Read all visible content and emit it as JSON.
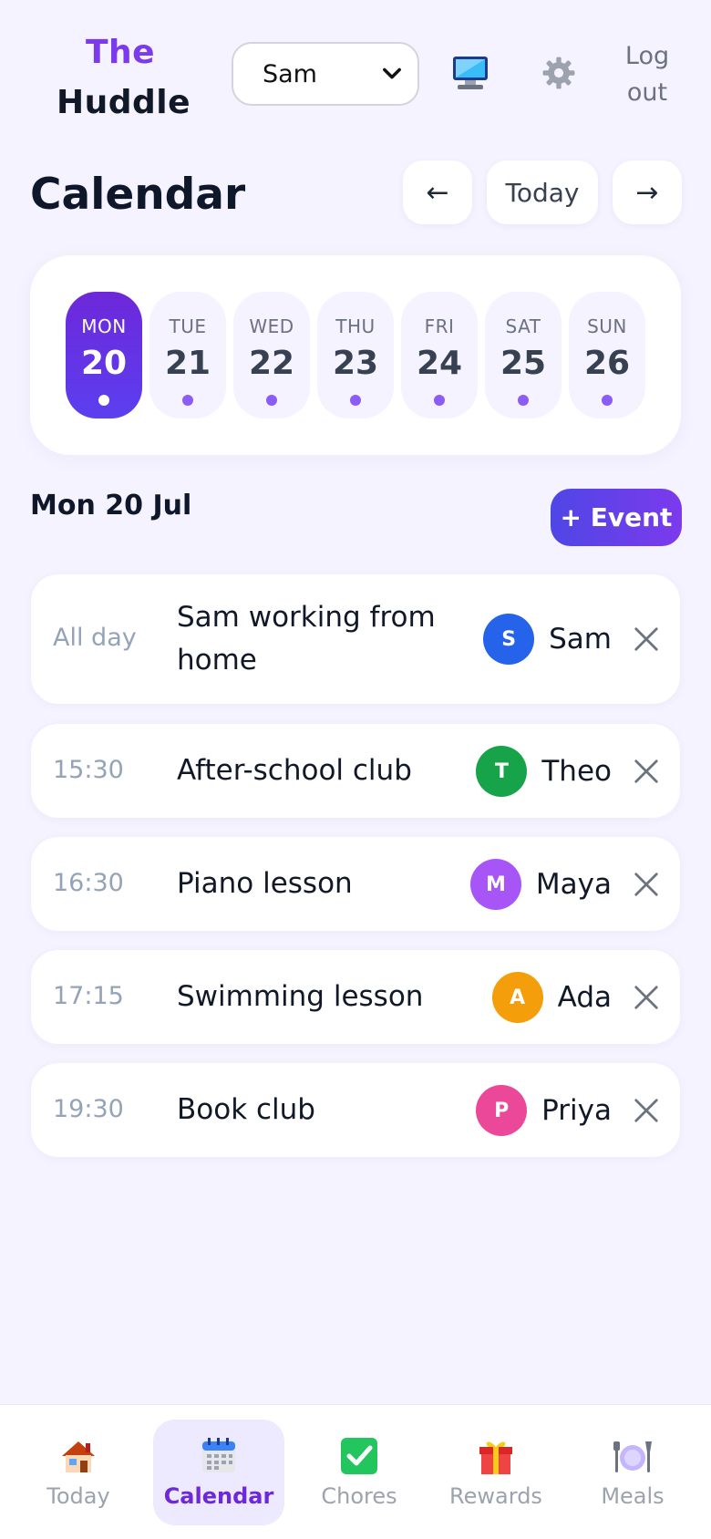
{
  "header": {
    "brand_line1": "The",
    "brand_line2": "Huddle",
    "user_select": {
      "value": "Sam"
    },
    "logout_label_1": "Log",
    "logout_label_2": "out"
  },
  "page": {
    "title": "Calendar",
    "prev_label": "←",
    "today_label": "Today",
    "next_label": "→"
  },
  "week": [
    {
      "name": "MON",
      "num": "20",
      "selected": true
    },
    {
      "name": "TUE",
      "num": "21",
      "selected": false
    },
    {
      "name": "WED",
      "num": "22",
      "selected": false
    },
    {
      "name": "THU",
      "num": "23",
      "selected": false
    },
    {
      "name": "FRI",
      "num": "24",
      "selected": false
    },
    {
      "name": "SAT",
      "num": "25",
      "selected": false
    },
    {
      "name": "SUN",
      "num": "26",
      "selected": false
    }
  ],
  "day_view": {
    "heading": "Mon 20 Jul",
    "add_event_label": "+ Event"
  },
  "events": [
    {
      "time": "All day",
      "title_line1": "Sam working from",
      "title_line2": "home",
      "initial": "S",
      "person": "Sam",
      "color": "#2563eb"
    },
    {
      "time": "15:30",
      "title_line1": "After-school club",
      "initial": "T",
      "person": "Theo",
      "color": "#16a34a"
    },
    {
      "time": "16:30",
      "title_line1": "Piano lesson",
      "initial": "M",
      "person": "Maya",
      "color": "#a855f7"
    },
    {
      "time": "17:15",
      "title_line1": "Swimming lesson",
      "initial": "A",
      "person": "Ada",
      "color": "#f59e0b"
    },
    {
      "time": "19:30",
      "title_line1": "Book club",
      "initial": "P",
      "person": "Priya",
      "color": "#ec4899"
    }
  ],
  "bottom_nav": [
    {
      "label": "Today",
      "icon": "house-icon",
      "active": false
    },
    {
      "label": "Calendar",
      "icon": "calendar-icon",
      "active": true
    },
    {
      "label": "Chores",
      "icon": "checkmark-icon",
      "active": false
    },
    {
      "label": "Rewards",
      "icon": "gift-icon",
      "active": false
    },
    {
      "label": "Meals",
      "icon": "plate-cutlery-icon",
      "active": false
    }
  ],
  "colors": {
    "accent": "#7c3aed",
    "background": "#f5f3ff"
  }
}
